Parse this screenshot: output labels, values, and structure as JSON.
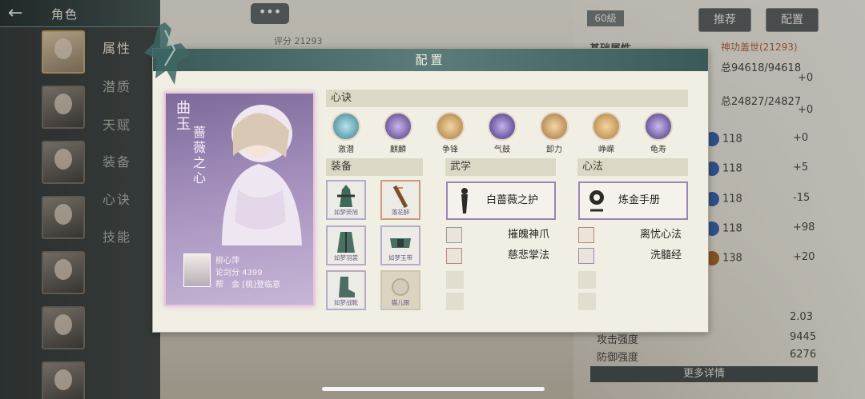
{
  "topbar": {
    "back_icon": "back-arrow-icon",
    "title": "角色"
  },
  "chat": {
    "label": "•••"
  },
  "header_right": {
    "level": "60級",
    "recommend": "推荐",
    "config": "配置"
  },
  "background": {
    "score": "评分 21293",
    "stats_title": "基础属性",
    "stats_value": "神功盖世(21293)",
    "totals": [
      {
        "text": "总94618/94618",
        "delta": "+0"
      },
      {
        "text": "总24827/24827",
        "delta": "+0"
      }
    ],
    "stat_rows": [
      {
        "value": "118",
        "delta": "+0",
        "color": "blue"
      },
      {
        "value": "118",
        "delta": "+5",
        "color": "blue"
      },
      {
        "value": "118",
        "delta": "-15",
        "color": "blue"
      },
      {
        "value": "118",
        "delta": "+98",
        "color": "blue"
      },
      {
        "value": "138",
        "delta": "+20",
        "color": "gold"
      }
    ],
    "bottom": [
      {
        "label": "",
        "value": "2.03"
      },
      {
        "label": "攻击强度",
        "value": "9445"
      },
      {
        "label": "防御强度",
        "value": "6276"
      }
    ],
    "more_details": "更多详情"
  },
  "sidebar": {
    "tabs": [
      {
        "label": "属性",
        "active": true
      },
      {
        "label": "潜质",
        "active": false
      },
      {
        "label": "天赋",
        "active": false
      },
      {
        "label": "装备",
        "active": false
      },
      {
        "label": "心诀",
        "active": false
      },
      {
        "label": "技能",
        "active": false
      }
    ]
  },
  "modal": {
    "title": "配置",
    "character": {
      "name": "曲玉",
      "title": "蔷薇之心",
      "owner_name": "柳心萍",
      "owner_score": "论剑分 4399",
      "owner_guild": "帮　会 [桃]登临意"
    },
    "xinjue": {
      "header": "心诀",
      "items": [
        {
          "label": "激潜",
          "color": "#5d9fb5"
        },
        {
          "label": "麒麟",
          "color": "#6a4f98"
        },
        {
          "label": "争锋",
          "color": "#c49a5a"
        },
        {
          "label": "气鼓",
          "color": "#5b4a92"
        },
        {
          "label": "卸力",
          "color": "#c08d4f"
        },
        {
          "label": "峥嵘",
          "color": "#c3914d"
        },
        {
          "label": "龟寿",
          "color": "#5e4f98"
        }
      ]
    },
    "equipment": {
      "header": "装备",
      "slots": [
        {
          "label": "如梦荧旭",
          "style": "purple"
        },
        {
          "label": "落花醉",
          "style": "orange"
        },
        {
          "label": "如梦羽裳",
          "style": "purple"
        },
        {
          "label": "如梦玉带",
          "style": "purple"
        },
        {
          "label": "如梦战靴",
          "style": "purple"
        },
        {
          "label": "猫儿眼",
          "style": "empty"
        }
      ]
    },
    "wuxue": {
      "header": "武学",
      "main": "白蔷薇之护",
      "items": [
        {
          "name": "摧魄神爪",
          "border": "gray"
        },
        {
          "name": "慈悲掌法",
          "border": "orange"
        }
      ]
    },
    "xinfa": {
      "header": "心法",
      "main": "炼金手册",
      "items": [
        {
          "name": "离忧心法",
          "border": "orange"
        },
        {
          "name": "洗髓经",
          "border": "purple"
        }
      ]
    }
  }
}
